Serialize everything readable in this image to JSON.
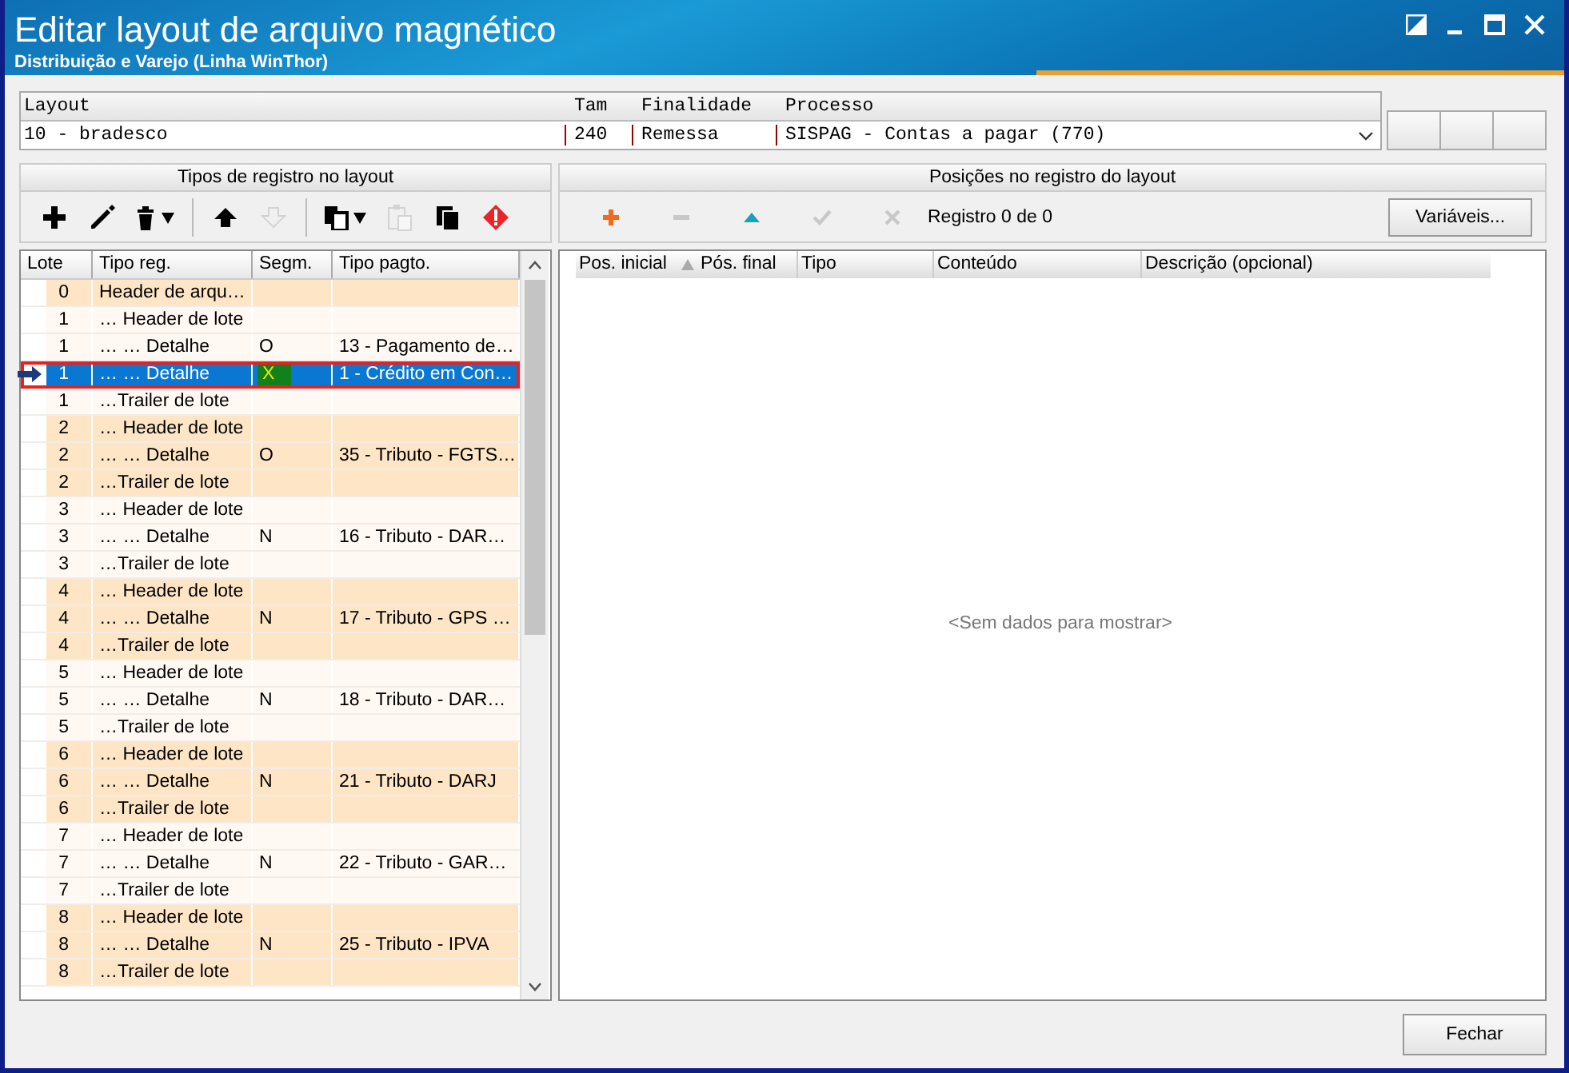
{
  "window": {
    "title": "Editar layout de arquivo magnético",
    "subtitle": "Distribuição e Varejo (Linha WinThor)"
  },
  "layout_selector": {
    "columns": [
      "Layout",
      "Tam",
      "Finalidade",
      "Processo"
    ],
    "values": [
      "10 - bradesco",
      "240",
      "Remessa",
      "SISPAG - Contas a pagar (770)"
    ]
  },
  "record_types": {
    "title": "Tipos de registro no layout",
    "toolbar": [
      {
        "kind": "add",
        "disabled": false
      },
      {
        "kind": "edit",
        "disabled": false
      },
      {
        "kind": "delete",
        "disabled": false
      },
      {
        "kind": "up",
        "disabled": false
      },
      {
        "kind": "down",
        "disabled": true
      },
      {
        "kind": "copy",
        "disabled": false
      },
      {
        "kind": "paste",
        "disabled": true
      },
      {
        "kind": "duplicate",
        "disabled": false
      },
      {
        "kind": "error",
        "disabled": false
      }
    ],
    "columns": [
      "Lote",
      "Tipo reg.",
      "Segm.",
      "Tipo pagto."
    ],
    "rows": [
      {
        "lote": "0",
        "tipo": "Header de arqu…",
        "segm": "",
        "pagto": "",
        "shaded": true,
        "selected": false
      },
      {
        "lote": "1",
        "tipo": "… Header de lote",
        "segm": "",
        "pagto": "",
        "shaded": false,
        "selected": false
      },
      {
        "lote": "1",
        "tipo": "… … Detalhe",
        "segm": "O",
        "pagto": "13 - Pagamento de…",
        "shaded": false,
        "selected": false
      },
      {
        "lote": "1",
        "tipo": "… … Detalhe",
        "segm": "X",
        "pagto": "1 - Crédito em Con…",
        "shaded": false,
        "selected": true
      },
      {
        "lote": "1",
        "tipo": "…Trailer de lote",
        "segm": "",
        "pagto": "",
        "shaded": false,
        "selected": false
      },
      {
        "lote": "2",
        "tipo": "… Header de lote",
        "segm": "",
        "pagto": "",
        "shaded": true,
        "selected": false
      },
      {
        "lote": "2",
        "tipo": "… … Detalhe",
        "segm": "O",
        "pagto": "35 - Tributo - FGTS…",
        "shaded": true,
        "selected": false
      },
      {
        "lote": "2",
        "tipo": "…Trailer de lote",
        "segm": "",
        "pagto": "",
        "shaded": true,
        "selected": false
      },
      {
        "lote": "3",
        "tipo": "… Header de lote",
        "segm": "",
        "pagto": "",
        "shaded": false,
        "selected": false
      },
      {
        "lote": "3",
        "tipo": "… … Detalhe",
        "segm": "N",
        "pagto": "16 - Tributo - DAR…",
        "shaded": false,
        "selected": false
      },
      {
        "lote": "3",
        "tipo": "…Trailer de lote",
        "segm": "",
        "pagto": "",
        "shaded": false,
        "selected": false
      },
      {
        "lote": "4",
        "tipo": "… Header de lote",
        "segm": "",
        "pagto": "",
        "shaded": true,
        "selected": false
      },
      {
        "lote": "4",
        "tipo": "… … Detalhe",
        "segm": "N",
        "pagto": "17 - Tributo - GPS …",
        "shaded": true,
        "selected": false
      },
      {
        "lote": "4",
        "tipo": "…Trailer de lote",
        "segm": "",
        "pagto": "",
        "shaded": true,
        "selected": false
      },
      {
        "lote": "5",
        "tipo": "… Header de lote",
        "segm": "",
        "pagto": "",
        "shaded": false,
        "selected": false
      },
      {
        "lote": "5",
        "tipo": "… … Detalhe",
        "segm": "N",
        "pagto": "18 - Tributo - DAR…",
        "shaded": false,
        "selected": false
      },
      {
        "lote": "5",
        "tipo": "…Trailer de lote",
        "segm": "",
        "pagto": "",
        "shaded": false,
        "selected": false
      },
      {
        "lote": "6",
        "tipo": "… Header de lote",
        "segm": "",
        "pagto": "",
        "shaded": true,
        "selected": false
      },
      {
        "lote": "6",
        "tipo": "… … Detalhe",
        "segm": "N",
        "pagto": "21 - Tributo - DARJ",
        "shaded": true,
        "selected": false
      },
      {
        "lote": "6",
        "tipo": "…Trailer de lote",
        "segm": "",
        "pagto": "",
        "shaded": true,
        "selected": false
      },
      {
        "lote": "7",
        "tipo": "… Header de lote",
        "segm": "",
        "pagto": "",
        "shaded": false,
        "selected": false
      },
      {
        "lote": "7",
        "tipo": "… … Detalhe",
        "segm": "N",
        "pagto": "22 - Tributo - GAR…",
        "shaded": false,
        "selected": false
      },
      {
        "lote": "7",
        "tipo": "…Trailer de lote",
        "segm": "",
        "pagto": "",
        "shaded": false,
        "selected": false
      },
      {
        "lote": "8",
        "tipo": "… Header de lote",
        "segm": "",
        "pagto": "",
        "shaded": true,
        "selected": false
      },
      {
        "lote": "8",
        "tipo": "… … Detalhe",
        "segm": "N",
        "pagto": "25 - Tributo - IPVA",
        "shaded": true,
        "selected": false
      },
      {
        "lote": "8",
        "tipo": "…Trailer de lote",
        "segm": "",
        "pagto": "",
        "shaded": true,
        "selected": false
      }
    ]
  },
  "positions": {
    "title": "Posições no registro do layout",
    "toolbar": [
      {
        "kind": "add",
        "disabled": false
      },
      {
        "kind": "remove",
        "disabled": true
      },
      {
        "kind": "up",
        "disabled": false
      },
      {
        "kind": "confirm",
        "disabled": true
      },
      {
        "kind": "cancel",
        "disabled": true
      }
    ],
    "record_counter": "Registro 0 de 0",
    "variables_button": "Variáveis...",
    "columns": [
      "Pos. inicial",
      "Pós. final",
      "Tipo",
      "Conteúdo",
      "Descrição (opcional)"
    ],
    "empty_message": "<Sem dados para mostrar>"
  },
  "buttons": [
    "Fechar"
  ]
}
